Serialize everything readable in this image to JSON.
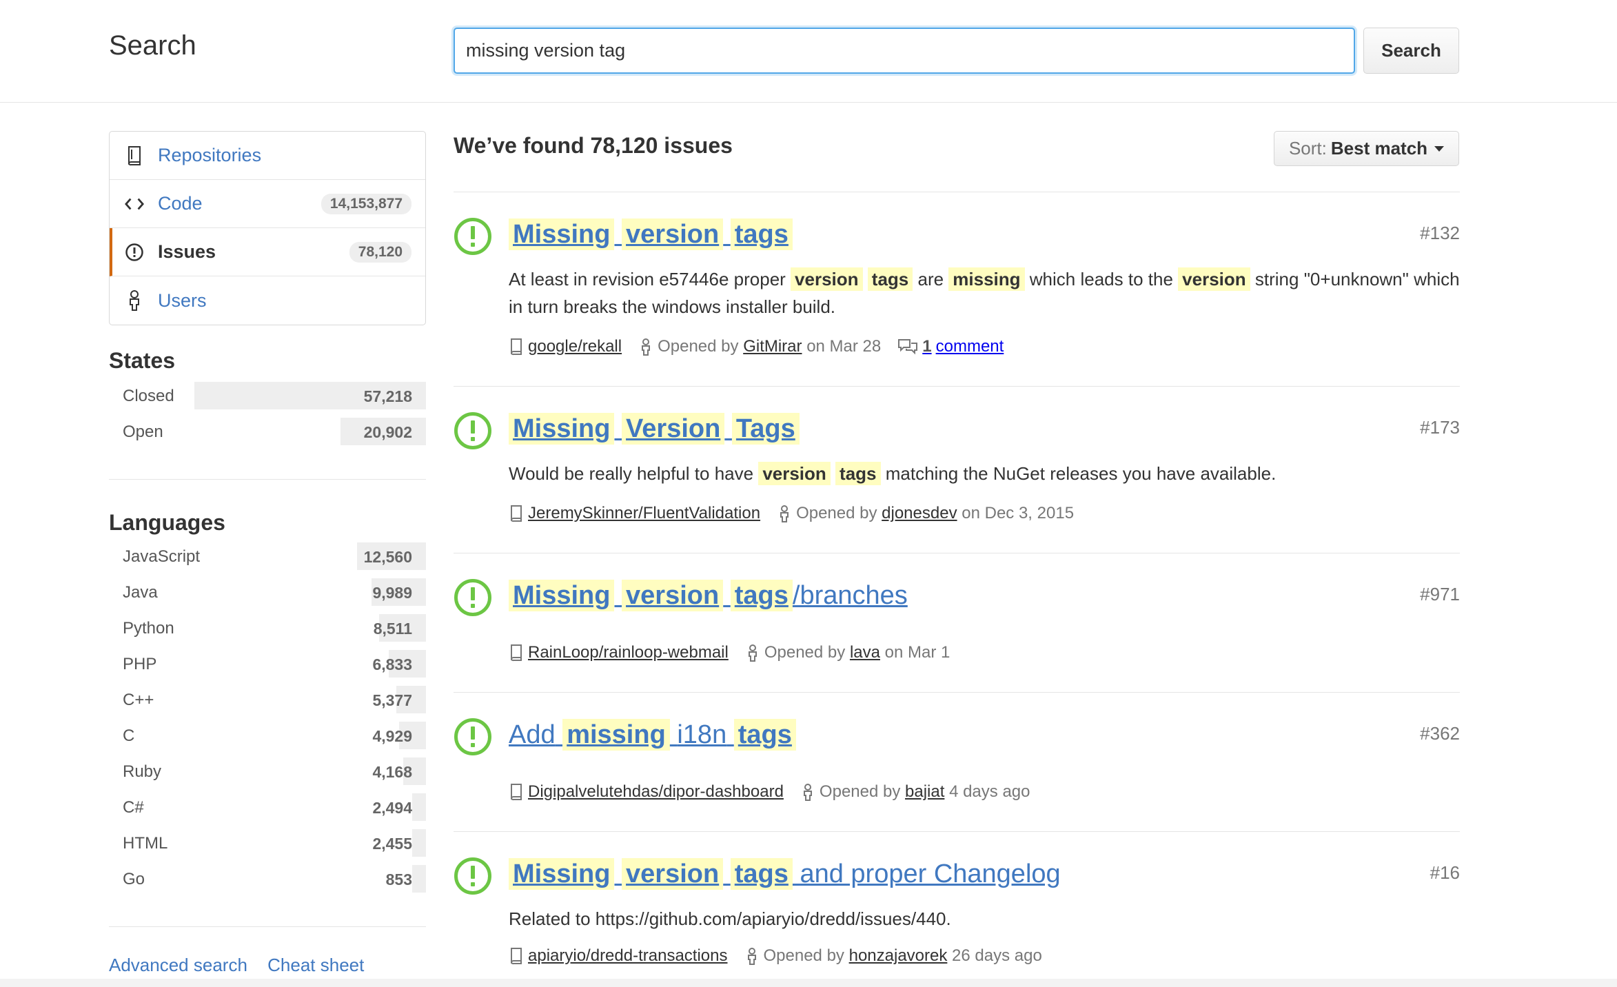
{
  "header": {
    "title": "Search",
    "query": "missing version tag",
    "search_button": "Search"
  },
  "nav": [
    {
      "label": "Repositories",
      "count": ""
    },
    {
      "label": "Code",
      "count": "14,153,877"
    },
    {
      "label": "Issues",
      "count": "78,120",
      "selected": true
    },
    {
      "label": "Users",
      "count": ""
    }
  ],
  "states": {
    "title": "States",
    "items": [
      {
        "label": "Closed",
        "count": "57,218",
        "share": 0.73
      },
      {
        "label": "Open",
        "count": "20,902",
        "share": 0.27
      }
    ]
  },
  "languages": {
    "title": "Languages",
    "items": [
      {
        "label": "JavaScript",
        "count": "12,560",
        "share": 0.195
      },
      {
        "label": "Java",
        "count": "9,989",
        "share": 0.155
      },
      {
        "label": "Python",
        "count": "8,511",
        "share": 0.132
      },
      {
        "label": "PHP",
        "count": "6,833",
        "share": 0.106
      },
      {
        "label": "C++",
        "count": "5,377",
        "share": 0.083
      },
      {
        "label": "C",
        "count": "4,929",
        "share": 0.076
      },
      {
        "label": "Ruby",
        "count": "4,168",
        "share": 0.065
      },
      {
        "label": "C#",
        "count": "2,494",
        "share": 0.039
      },
      {
        "label": "HTML",
        "count": "2,455",
        "share": 0.038
      },
      {
        "label": "Go",
        "count": "853",
        "share": 0.013
      }
    ]
  },
  "footer": {
    "advanced_search": "Advanced search",
    "cheat_sheet": "Cheat sheet"
  },
  "results": {
    "heading": "We’ve found 78,120 issues",
    "sort_prefix": "Sort:",
    "sort_value": "Best match",
    "items": [
      {
        "number": "#132",
        "repo": "google/rekall",
        "opened_by": "Opened by",
        "author": "GitMirar",
        "when": "on Mar 28",
        "comment_count": "1",
        "comment_label": "comment"
      },
      {
        "number": "#173",
        "repo": "JeremySkinner/FluentValidation",
        "opened_by": "Opened by",
        "author": "djonesdev",
        "when": "on Dec 3, 2015"
      },
      {
        "number": "#971",
        "repo": "RainLoop/rainloop-webmail",
        "opened_by": "Opened by",
        "author": "lava",
        "when": "on Mar 1"
      },
      {
        "number": "#362",
        "repo": "Digipalvelutehdas/dipor-dashboard",
        "opened_by": "Opened by",
        "author": "bajiat",
        "when": "4 days ago"
      },
      {
        "number": "#16",
        "repo": "apiaryio/dredd-transactions",
        "opened_by": "Opened by",
        "author": "honzajavorek",
        "when": "26 days ago"
      }
    ],
    "titles": [
      [
        "Missing",
        "version",
        "tags"
      ],
      [
        "Missing",
        "Version",
        "Tags"
      ],
      [
        "Missing",
        "version",
        "tags",
        "/branches"
      ],
      [
        "Add",
        "missing",
        "i18n",
        "tags"
      ],
      [
        "Missing",
        "version",
        "tags",
        "and proper Changelog"
      ]
    ],
    "bodies": [
      [
        "At least in revision e57446e proper",
        "version",
        "tags",
        "are",
        "missing",
        "which leads to the",
        "version",
        "string \"0+unknown\" which in turn breaks the windows installer build."
      ],
      [
        "Would be really helpful to have",
        "version",
        "tags",
        "matching the NuGet releases you have available."
      ],
      [],
      [],
      [
        "Related to https://github.com/apiaryio/dredd/issues/440."
      ]
    ]
  },
  "colors": {
    "link": "#4078c0",
    "highlight": "#fffdc0",
    "open_issue": "#6cc644",
    "selected_nav": "#d26911"
  }
}
